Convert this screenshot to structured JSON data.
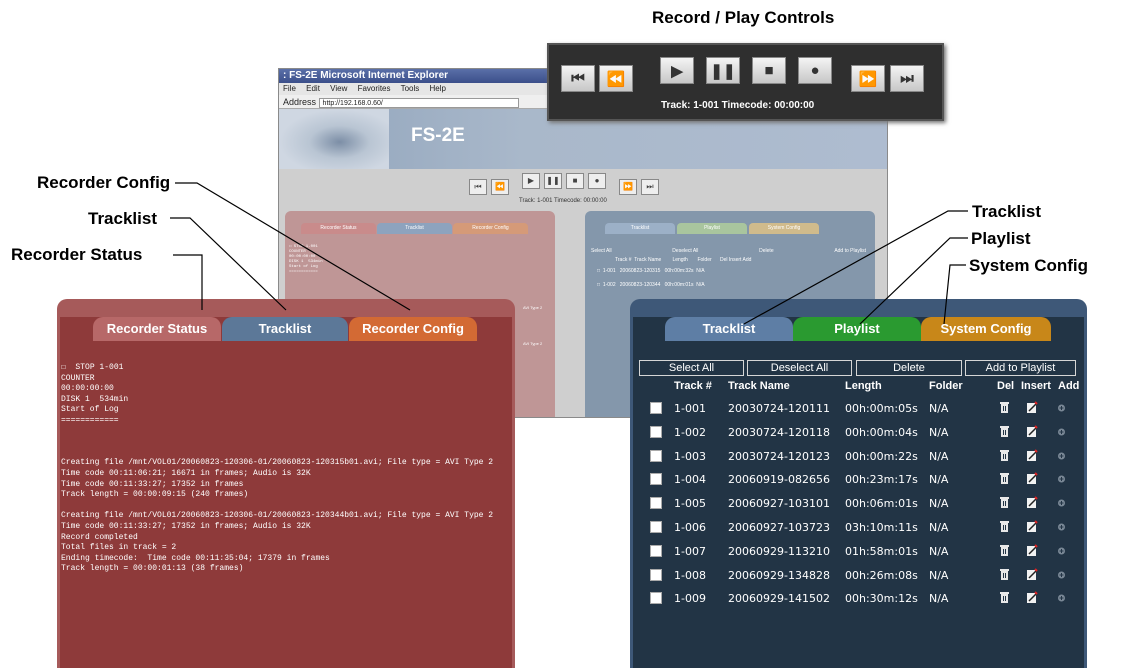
{
  "callouts": {
    "controls": "Record / Play Controls",
    "recorder_config": "Recorder Config",
    "tracklist_left": "Tracklist",
    "recorder_status": "Recorder Status",
    "tracklist_right": "Tracklist",
    "playlist": "Playlist",
    "system_config": "System Config"
  },
  "browser": {
    "title": ": FS-2E   Microsoft Internet Explorer",
    "menu": [
      "File",
      "Edit",
      "View",
      "Favorites",
      "Tools",
      "Help"
    ],
    "address_label": "Address",
    "address": "http://192.168.0.60/",
    "logo": "FS-2E",
    "status": "Track: 1-001   Timecode: 00:00:00"
  },
  "controls": {
    "status": "Track: 1-001   Timecode: 00:00:00",
    "buttons": [
      "skip-back",
      "rewind",
      "play",
      "pause",
      "stop",
      "record",
      "fast-forward",
      "skip-forward"
    ]
  },
  "left_panel": {
    "tabs": [
      "Recorder Status",
      "Tracklist",
      "Recorder Config"
    ],
    "log": "☐  STOP 1-001\nCOUNTER\n00:00:00:00\nDISK 1  534min\nStart of Log\n============\n\n\n\nCreating file /mnt/VOL01/20060823-120306-01/20060823-120315b01.avi; File type = AVI Type 2\nTime code 00:11:06:21; 16671 in frames; Audio is 32K\nTime code 00:11:33:27; 17352 in frames\nTrack length = 00:00:09:15 (240 frames)\n\nCreating file /mnt/VOL01/20060823-120306-01/20060823-120344b01.avi; File type = AVI Type 2\nTime code 00:11:33:27; 17352 in frames; Audio is 32K\nRecord completed\nTotal files in track = 2\nEnding timecode:  Time code 00:11:35:04; 17379 in frames\nTrack length = 00:00:01:13 (38 frames)"
  },
  "right_panel": {
    "tabs": [
      "Tracklist",
      "Playlist",
      "System Config"
    ],
    "buttons": [
      "Select All",
      "Deselect All",
      "Delete",
      "Add to Playlist"
    ],
    "headers": [
      "Track #",
      "Track Name",
      "Length",
      "Folder",
      "Del",
      "Insert",
      "Add"
    ],
    "rows": [
      [
        "1-001",
        "20030724-120111",
        "00h:00m:05s",
        "N/A"
      ],
      [
        "1-002",
        "20030724-120118",
        "00h:00m:04s",
        "N/A"
      ],
      [
        "1-003",
        "20030724-120123",
        "00h:00m:22s",
        "N/A"
      ],
      [
        "1-004",
        "20060919-082656",
        "00h:23m:17s",
        "N/A"
      ],
      [
        "1-005",
        "20060927-103101",
        "00h:06m:01s",
        "N/A"
      ],
      [
        "1-006",
        "20060927-103723",
        "03h:10m:11s",
        "N/A"
      ],
      [
        "1-007",
        "20060929-113210",
        "01h:58m:01s",
        "N/A"
      ],
      [
        "1-008",
        "20060929-134828",
        "00h:26m:08s",
        "N/A"
      ],
      [
        "1-009",
        "20060929-141502",
        "00h:30m:12s",
        "N/A"
      ]
    ]
  },
  "mini_right": {
    "tabs": [
      "Tracklist",
      "Playlist",
      "System Config"
    ],
    "buttons": [
      "Select All",
      "Deselect All",
      "Delete",
      "Add to Playlist"
    ],
    "headers": [
      "Track #",
      "Track Name",
      "Length",
      "Folder",
      "Del",
      "Insert",
      "Add"
    ],
    "rows": [
      [
        "1-001",
        "20060823-120315",
        "00h:00m:32s",
        "N/A"
      ],
      [
        "1-002",
        "20060823-120344",
        "00h:00m:01s",
        "N/A"
      ]
    ]
  },
  "mini_left": {
    "log": "☐ STOP 1-001\nCOUNTER\n00:00:00:00\nDISK 1  534min\nStart of Log\n============"
  },
  "mini_fragments": [
    "AVI Type 2",
    "AVI Type 2"
  ]
}
